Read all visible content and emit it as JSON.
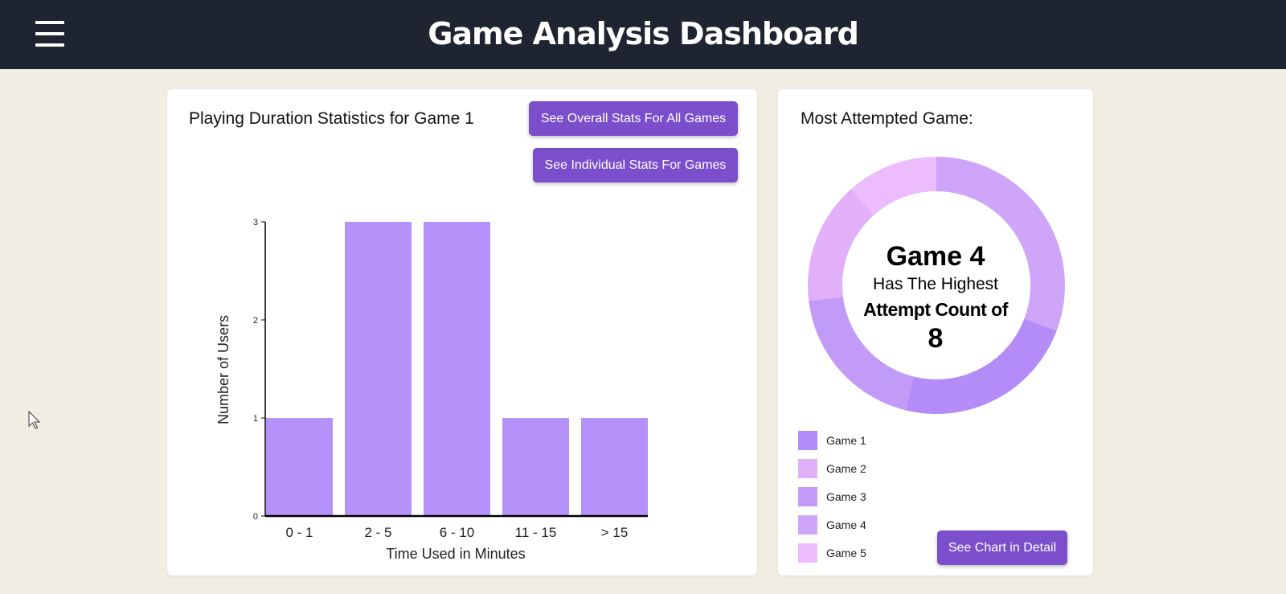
{
  "header": {
    "title": "Game Analysis Dashboard",
    "menu_icon": "hamburger-icon"
  },
  "duration_card": {
    "title": "Playing Duration Statistics for Game 1",
    "overall_button": "See Overall Stats For All Games",
    "individual_button": "See Individual Stats For Games"
  },
  "attempt_card": {
    "title": "Most Attempted Game:",
    "center_game": "Game 4",
    "center_line2": "Has The Highest",
    "center_line3": "Attempt Count of",
    "center_count": "8",
    "detail_button": "See Chart in Detail"
  },
  "colors": {
    "header": "#1e2430",
    "background": "#f0ede3",
    "button": "#7b4fcc",
    "bar": "#b591fa"
  },
  "chart_data": [
    {
      "type": "bar",
      "categories": [
        "0 - 1",
        "2 - 5",
        "6 - 10",
        "11 - 15",
        "> 15"
      ],
      "values": [
        1,
        3,
        3,
        1,
        1
      ],
      "xlabel": "Time Used in Minutes",
      "ylabel": "Number of Users",
      "ylim": [
        0,
        3
      ],
      "yticks": [
        "0",
        "1",
        "2",
        "3"
      ],
      "grid": false
    },
    {
      "type": "pie",
      "donut": true,
      "labels": [
        "Game 1",
        "Game 2",
        "Game 3",
        "Game 4",
        "Game 5"
      ],
      "values": [
        6,
        4,
        5,
        8,
        3
      ],
      "colors": [
        "#b48cf8",
        "#e2b0f8",
        "#c29bf8",
        "#cfa5f9",
        "#ecbcfc"
      ],
      "legend": "bottom-left"
    }
  ]
}
